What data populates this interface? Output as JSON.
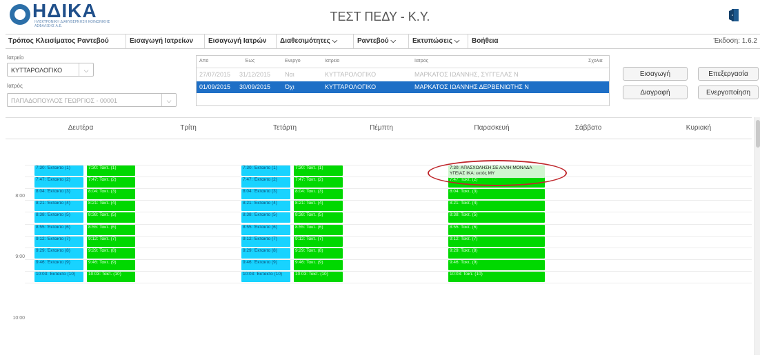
{
  "header": {
    "logo_text": "ΗΔΙΚΑ",
    "logo_subtitle": "ΗΛΕΚΤΡΟΝΙΚΗ ΔΙΑΚΥΒΕΡΝΗΣΗ ΚΟΙΝΩΝΙΚΗΣ ΑΣΦΑΛΙΣΗΣ Α.Ε.",
    "title": "ΤΕΣΤ ΠΕΔΥ - Κ.Υ.",
    "exit_icon": "exit-door-icon"
  },
  "menu": {
    "items": [
      "Τρόπος Κλεισίματος Ραντεβού",
      "Εισαγωγή Ιατρείων",
      "Εισαγωγή Ιατρών",
      "Διαθεσιμότητες ⌵",
      "Ραντεβού ⌵",
      "Εκτυπώσεις ⌵",
      "Βοήθεια"
    ],
    "version": "Έκδοση: 1.6.2"
  },
  "filters": {
    "clinic_label": "Ιατρείο",
    "clinic_value": "ΚΥΤΤΑΡΟΛΟΓΙΚΟ",
    "doctor_label": "Ιατρός",
    "doctor_value": "ΠΑΠΑΔΟΠΟΥΛΟΣ ΓΕΩΡΓΙΟΣ - 00001"
  },
  "availability": {
    "headers": [
      "Από",
      "Έως",
      "Ενεργό",
      "Ιατρείο",
      "Ιατρός",
      "Σχόλια"
    ],
    "rows": [
      [
        "27/07/2015",
        "31/12/2015",
        "Ναι",
        "ΚΥΤΤΑΡΟΛΟΓΙΚΟ",
        "ΜΑΡΚΑΤΟΣ ΙΩΑΝΝΗΣ, ΣΥΓΓΕΛΑΣ Ν",
        ""
      ],
      [
        "01/09/2015",
        "30/09/2015",
        "Όχι",
        "ΚΥΤΤΑΡΟΛΟΓΙΚΟ",
        "ΜΑΡΚΑΤΟΣ ΙΩΑΝΝΗΣ ΔΕΡΒΕΝΙΩΤΗΣ Ν",
        ""
      ]
    ]
  },
  "buttons": {
    "insert": "Εισαγωγή",
    "edit": "Επεξεργασία",
    "delete": "Διαγραφή",
    "activate": "Ενεργοποίηση"
  },
  "calendar": {
    "days": [
      "Δευτέρα",
      "Τρίτη",
      "Τετάρτη",
      "Πέμπτη",
      "Παρασκευή",
      "Σάββατο",
      "Κυριακή"
    ],
    "hours": [
      "8:00",
      "9:00",
      "10:00"
    ],
    "monday_extra": [
      "7:30: Έκτακτο (1)",
      "7:47: Έκτακτο (2)",
      "8:04: Έκτακτο (3)",
      "8:21: Έκτακτο (4)",
      "8:38: Έκτακτο (5)",
      "8:55: Έκτακτο (6)",
      "9:12: Έκτακτο (7)",
      "9:29: Έκτακτο (8)",
      "9:46: Έκτακτο (9)",
      "10:03: Έκτακτο (10)"
    ],
    "monday_regular": [
      "7:30: Τακτ. (1)",
      "7:47: Τακτ. (2)",
      "8:04: Τακτ. (3)",
      "8:21: Τακτ. (4)",
      "8:38: Τακτ. (5)",
      "8:55: Τακτ. (6)",
      "9:12: Τακτ. (7)",
      "9:29: Τακτ. (8)",
      "9:46: Τακτ. (9)",
      "10:03: Τακτ. (10)"
    ],
    "wednesday_extra": [
      "7:30: Έκτακτο (1)",
      "7:47: Έκτακτο (2)",
      "8:04: Έκτακτο (3)",
      "8:21: Έκτακτο (4)",
      "8:38: Έκτακτο (5)",
      "8:55: Έκτακτο (6)",
      "9:12: Έκτακτο (7)",
      "9:29: Έκτακτο (8)",
      "9:46: Έκτακτο (9)",
      "10:03: Έκτακτο (10)"
    ],
    "wednesday_regular": [
      "7:30: Τακτ. (1)",
      "7:47: Τακτ. (2)",
      "8:04: Τακτ. (3)",
      "8:21: Τακτ. (4)",
      "8:38: Τακτ. (5)",
      "8:55: Τακτ. (6)",
      "9:12: Τακτ. (7)",
      "9:29: Τακτ. (8)",
      "9:46: Τακτ. (9)",
      "10:03: Τακτ. (10)"
    ],
    "friday_blocked": "7:30: ΑΠΑΣΧΟΛΗΣΗ ΣΕ ΑΛΛΗ ΜΟΝΑΔΑ ΥΓΕΙΑΣ ΙΚΑ: εκτός ΜΥ",
    "friday_regular": [
      "7:47: Τακτ. (2)",
      "8:04: Τακτ. (3)",
      "8:21: Τακτ. (4)",
      "8:38: Τακτ. (5)",
      "8:55: Τακτ. (6)",
      "9:12: Τακτ. (7)",
      "9:29: Τακτ. (8)",
      "9:46: Τακτ. (9)",
      "10:03: Τακτ. (10)"
    ]
  },
  "colors": {
    "extra_slot": "#18d3ff",
    "regular_slot": "#00d800",
    "blocked_slot": "#cff5cf",
    "selected_row": "#1e6fc6",
    "highlight": "#c0282d"
  }
}
